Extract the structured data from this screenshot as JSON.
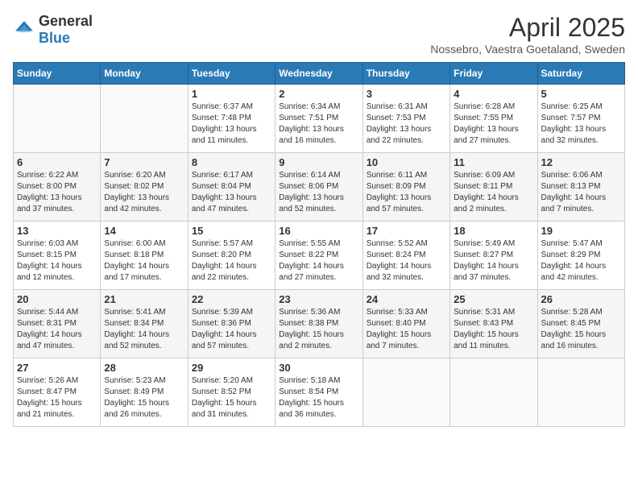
{
  "header": {
    "logo_general": "General",
    "logo_blue": "Blue",
    "month_title": "April 2025",
    "location": "Nossebro, Vaestra Goetaland, Sweden"
  },
  "weekdays": [
    "Sunday",
    "Monday",
    "Tuesday",
    "Wednesday",
    "Thursday",
    "Friday",
    "Saturday"
  ],
  "weeks": [
    [
      {
        "day": "",
        "sunrise": "",
        "sunset": "",
        "daylight": ""
      },
      {
        "day": "",
        "sunrise": "",
        "sunset": "",
        "daylight": ""
      },
      {
        "day": "1",
        "sunrise": "Sunrise: 6:37 AM",
        "sunset": "Sunset: 7:48 PM",
        "daylight": "Daylight: 13 hours and 11 minutes."
      },
      {
        "day": "2",
        "sunrise": "Sunrise: 6:34 AM",
        "sunset": "Sunset: 7:51 PM",
        "daylight": "Daylight: 13 hours and 16 minutes."
      },
      {
        "day": "3",
        "sunrise": "Sunrise: 6:31 AM",
        "sunset": "Sunset: 7:53 PM",
        "daylight": "Daylight: 13 hours and 22 minutes."
      },
      {
        "day": "4",
        "sunrise": "Sunrise: 6:28 AM",
        "sunset": "Sunset: 7:55 PM",
        "daylight": "Daylight: 13 hours and 27 minutes."
      },
      {
        "day": "5",
        "sunrise": "Sunrise: 6:25 AM",
        "sunset": "Sunset: 7:57 PM",
        "daylight": "Daylight: 13 hours and 32 minutes."
      }
    ],
    [
      {
        "day": "6",
        "sunrise": "Sunrise: 6:22 AM",
        "sunset": "Sunset: 8:00 PM",
        "daylight": "Daylight: 13 hours and 37 minutes."
      },
      {
        "day": "7",
        "sunrise": "Sunrise: 6:20 AM",
        "sunset": "Sunset: 8:02 PM",
        "daylight": "Daylight: 13 hours and 42 minutes."
      },
      {
        "day": "8",
        "sunrise": "Sunrise: 6:17 AM",
        "sunset": "Sunset: 8:04 PM",
        "daylight": "Daylight: 13 hours and 47 minutes."
      },
      {
        "day": "9",
        "sunrise": "Sunrise: 6:14 AM",
        "sunset": "Sunset: 8:06 PM",
        "daylight": "Daylight: 13 hours and 52 minutes."
      },
      {
        "day": "10",
        "sunrise": "Sunrise: 6:11 AM",
        "sunset": "Sunset: 8:09 PM",
        "daylight": "Daylight: 13 hours and 57 minutes."
      },
      {
        "day": "11",
        "sunrise": "Sunrise: 6:09 AM",
        "sunset": "Sunset: 8:11 PM",
        "daylight": "Daylight: 14 hours and 2 minutes."
      },
      {
        "day": "12",
        "sunrise": "Sunrise: 6:06 AM",
        "sunset": "Sunset: 8:13 PM",
        "daylight": "Daylight: 14 hours and 7 minutes."
      }
    ],
    [
      {
        "day": "13",
        "sunrise": "Sunrise: 6:03 AM",
        "sunset": "Sunset: 8:15 PM",
        "daylight": "Daylight: 14 hours and 12 minutes."
      },
      {
        "day": "14",
        "sunrise": "Sunrise: 6:00 AM",
        "sunset": "Sunset: 8:18 PM",
        "daylight": "Daylight: 14 hours and 17 minutes."
      },
      {
        "day": "15",
        "sunrise": "Sunrise: 5:57 AM",
        "sunset": "Sunset: 8:20 PM",
        "daylight": "Daylight: 14 hours and 22 minutes."
      },
      {
        "day": "16",
        "sunrise": "Sunrise: 5:55 AM",
        "sunset": "Sunset: 8:22 PM",
        "daylight": "Daylight: 14 hours and 27 minutes."
      },
      {
        "day": "17",
        "sunrise": "Sunrise: 5:52 AM",
        "sunset": "Sunset: 8:24 PM",
        "daylight": "Daylight: 14 hours and 32 minutes."
      },
      {
        "day": "18",
        "sunrise": "Sunrise: 5:49 AM",
        "sunset": "Sunset: 8:27 PM",
        "daylight": "Daylight: 14 hours and 37 minutes."
      },
      {
        "day": "19",
        "sunrise": "Sunrise: 5:47 AM",
        "sunset": "Sunset: 8:29 PM",
        "daylight": "Daylight: 14 hours and 42 minutes."
      }
    ],
    [
      {
        "day": "20",
        "sunrise": "Sunrise: 5:44 AM",
        "sunset": "Sunset: 8:31 PM",
        "daylight": "Daylight: 14 hours and 47 minutes."
      },
      {
        "day": "21",
        "sunrise": "Sunrise: 5:41 AM",
        "sunset": "Sunset: 8:34 PM",
        "daylight": "Daylight: 14 hours and 52 minutes."
      },
      {
        "day": "22",
        "sunrise": "Sunrise: 5:39 AM",
        "sunset": "Sunset: 8:36 PM",
        "daylight": "Daylight: 14 hours and 57 minutes."
      },
      {
        "day": "23",
        "sunrise": "Sunrise: 5:36 AM",
        "sunset": "Sunset: 8:38 PM",
        "daylight": "Daylight: 15 hours and 2 minutes."
      },
      {
        "day": "24",
        "sunrise": "Sunrise: 5:33 AM",
        "sunset": "Sunset: 8:40 PM",
        "daylight": "Daylight: 15 hours and 7 minutes."
      },
      {
        "day": "25",
        "sunrise": "Sunrise: 5:31 AM",
        "sunset": "Sunset: 8:43 PM",
        "daylight": "Daylight: 15 hours and 11 minutes."
      },
      {
        "day": "26",
        "sunrise": "Sunrise: 5:28 AM",
        "sunset": "Sunset: 8:45 PM",
        "daylight": "Daylight: 15 hours and 16 minutes."
      }
    ],
    [
      {
        "day": "27",
        "sunrise": "Sunrise: 5:26 AM",
        "sunset": "Sunset: 8:47 PM",
        "daylight": "Daylight: 15 hours and 21 minutes."
      },
      {
        "day": "28",
        "sunrise": "Sunrise: 5:23 AM",
        "sunset": "Sunset: 8:49 PM",
        "daylight": "Daylight: 15 hours and 26 minutes."
      },
      {
        "day": "29",
        "sunrise": "Sunrise: 5:20 AM",
        "sunset": "Sunset: 8:52 PM",
        "daylight": "Daylight: 15 hours and 31 minutes."
      },
      {
        "day": "30",
        "sunrise": "Sunrise: 5:18 AM",
        "sunset": "Sunset: 8:54 PM",
        "daylight": "Daylight: 15 hours and 36 minutes."
      },
      {
        "day": "",
        "sunrise": "",
        "sunset": "",
        "daylight": ""
      },
      {
        "day": "",
        "sunrise": "",
        "sunset": "",
        "daylight": ""
      },
      {
        "day": "",
        "sunrise": "",
        "sunset": "",
        "daylight": ""
      }
    ]
  ]
}
